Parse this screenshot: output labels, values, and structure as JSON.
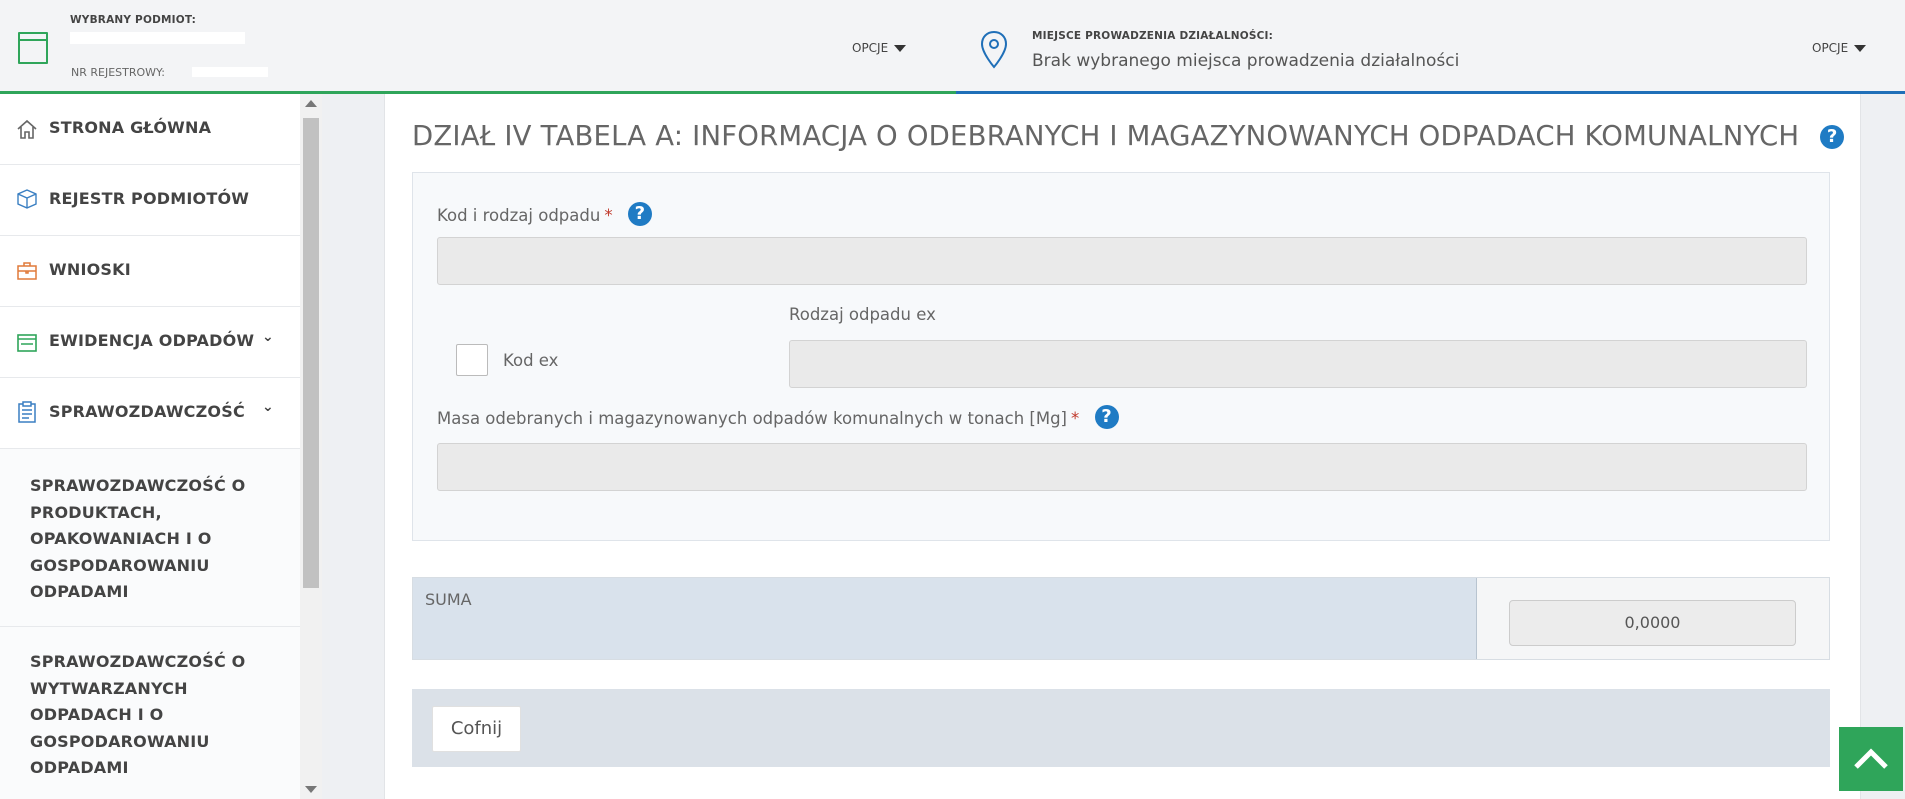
{
  "topbar": {
    "subject_label": "WYBRANY PODMIOT:",
    "register_label": "NR REJESTROWY:",
    "options_label": "OPCJE",
    "place_label": "MIEJSCE PROWADZENIA DZIAŁALNOŚCI:",
    "place_value": "Brak wybranego miejsca prowadzenia działalności",
    "options_label_right": "OPCJE"
  },
  "sidebar": {
    "items": [
      {
        "label": "STRONA GŁÓWNA",
        "icon": "home-icon"
      },
      {
        "label": "REJESTR PODMIOTÓW",
        "icon": "cube-icon"
      },
      {
        "label": "WNIOSKI",
        "icon": "briefcase-icon"
      },
      {
        "label": "EWIDENCJA ODPADÓW",
        "icon": "card-icon",
        "chevron": "chevron-down"
      },
      {
        "label": "SPRAWOZDAWCZOŚĆ",
        "icon": "clipboard-icon",
        "chevron": "chevron-down"
      }
    ],
    "subitems": [
      {
        "label": "SPRAWOZDAWCZOŚĆ O PRODUKTACH, OPAKOWANIACH I O GOSPODAROWANIU ODPADAMI"
      },
      {
        "label": "SPRAWOZDAWCZOŚĆ O WYTWARZANYCH ODPADACH I O GOSPODAROWANIU ODPADAMI"
      }
    ]
  },
  "main": {
    "title": "DZIAŁ IV TABELA A: INFORMACJA O ODEBRANYCH I MAGAZYNOWANYCH ODPADACH KOMUNALNYCH",
    "form": {
      "waste_code_label": "Kod i rodzaj odpadu",
      "waste_code_value": "",
      "ex_type_label": "Rodzaj odpadu ex",
      "ex_type_value": "",
      "kod_ex_label": "Kod ex",
      "kod_ex_checked": false,
      "mass_label": "Masa odebranych i magazynowanych odpadów komunalnych w tonach [Mg]",
      "mass_value": "",
      "required_mark": "*"
    },
    "sum": {
      "label": "SUMA",
      "value": "0,0000"
    },
    "back_button": "Cofnij"
  },
  "colors": {
    "accent_green": "#2fa55a",
    "accent_blue": "#1f6fb8",
    "help_blue": "#1f7bc4",
    "required_red": "#c0392b"
  }
}
